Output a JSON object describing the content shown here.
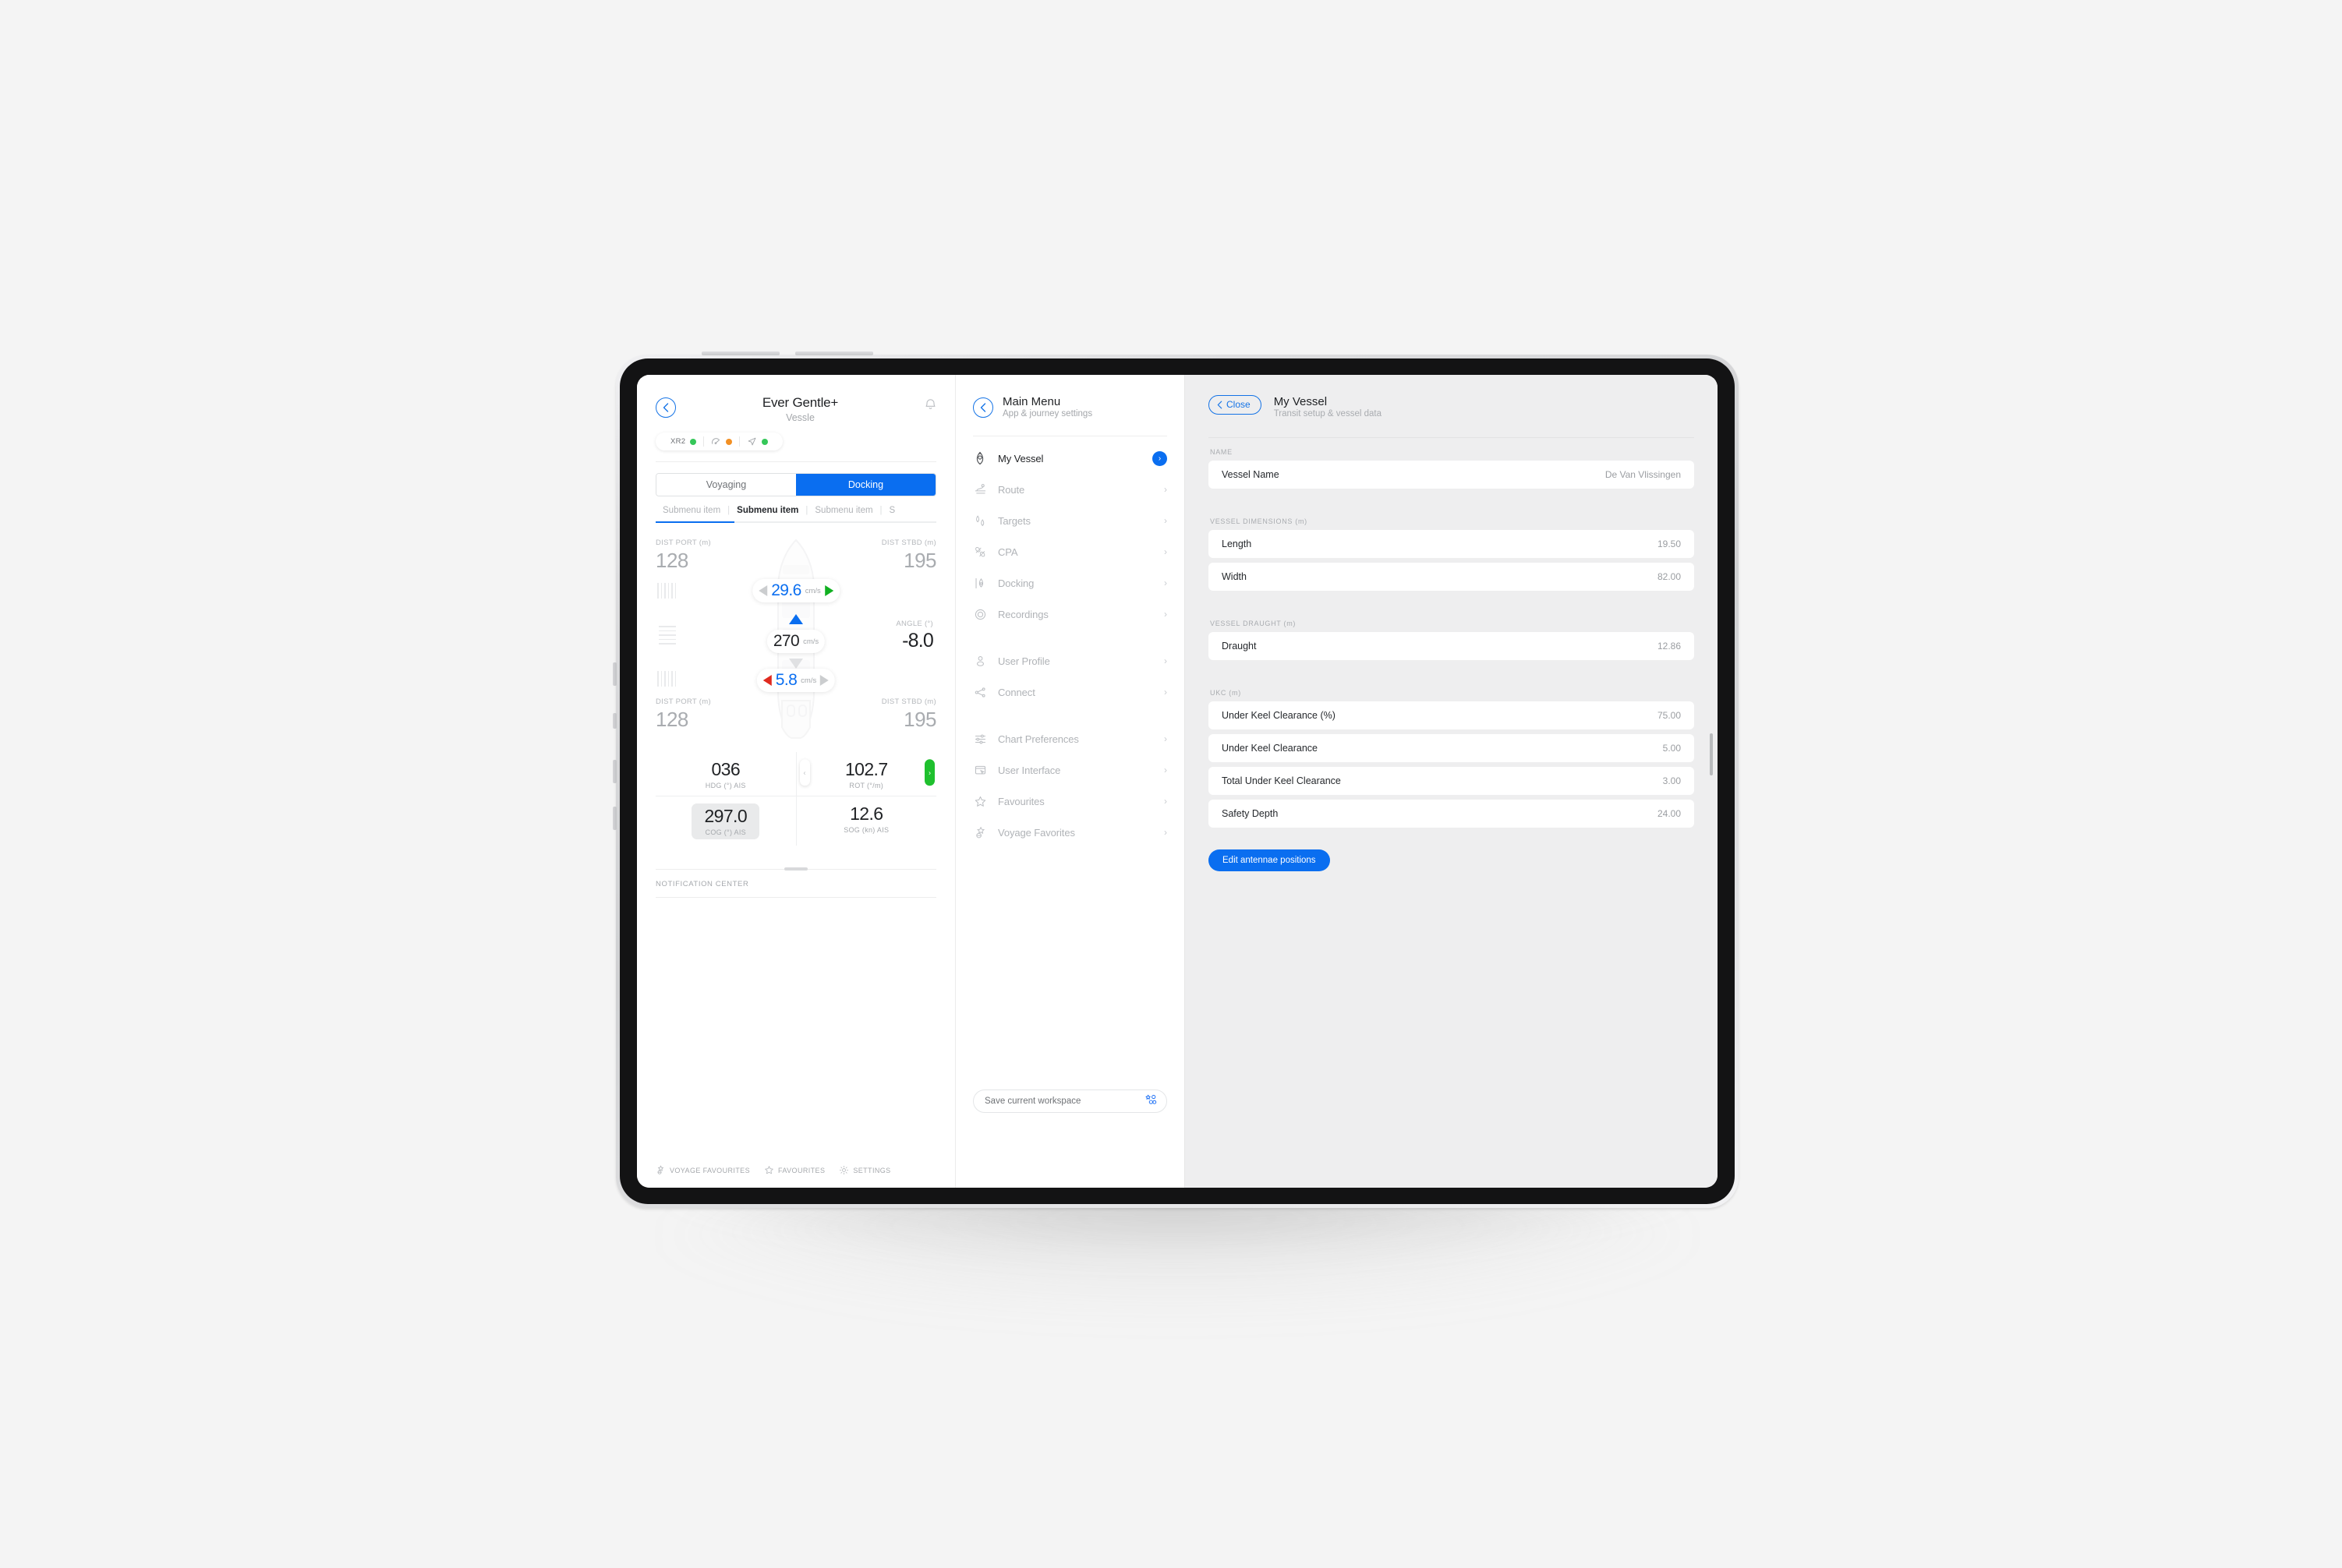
{
  "left_panel": {
    "back_icon": "chevron-left-icon",
    "title": "Ever Gentle+",
    "subtitle": "Vessle",
    "bell_icon": "bell-icon",
    "status": [
      {
        "label": "XR2",
        "icon": "text-label",
        "dot_color": "#35c759"
      },
      {
        "label": "",
        "icon": "gauge-icon",
        "dot_color": "#f29024"
      },
      {
        "label": "",
        "icon": "navigation-arrow-icon",
        "dot_color": "#35c759"
      }
    ],
    "segments": [
      {
        "label": "Voyaging",
        "active": false
      },
      {
        "label": "Docking",
        "active": true
      }
    ],
    "submenu": [
      {
        "label": "Submenu item",
        "active": false
      },
      {
        "label": "Submenu item",
        "active": true
      },
      {
        "label": "Submenu item",
        "active": false
      },
      {
        "label": "S",
        "active": false
      }
    ],
    "docking": {
      "dist_port_top_label": "DIST PORT (m)",
      "dist_port_top_value": "128",
      "dist_stbd_top_label": "DIST STBD (m)",
      "dist_stbd_top_value": "195",
      "dist_port_bottom_label": "DIST PORT (m)",
      "dist_port_bottom_value": "128",
      "dist_stbd_bottom_label": "DIST STBD (m)",
      "dist_stbd_bottom_value": "195",
      "bow_value": "29.6",
      "bow_unit": "cm/s",
      "center_value": "270",
      "center_unit": "cm/s",
      "stern_value": "5.8",
      "stern_unit": "cm/s",
      "angle_label": "ANGLE (°)",
      "angle_value": "-8.0"
    },
    "instruments": [
      {
        "value": "036",
        "caption": "HDG (°) AIS",
        "highlight": false,
        "stepper": false
      },
      {
        "value": "102.7",
        "caption": "ROT (°/m)",
        "highlight": false,
        "stepper": true
      },
      {
        "value": "297.0",
        "caption": "COG (°) AIS",
        "highlight": true,
        "stepper": false
      },
      {
        "value": "12.6",
        "caption": "SOG (kn) AIS",
        "highlight": false,
        "stepper": false
      }
    ],
    "stepper_left_icon": "chevron-left-icon",
    "stepper_right_icon": "chevron-right-icon",
    "notification_center_label": "NOTIFICATION CENTER",
    "footer": [
      {
        "label": "VOYAGE FAVOURITES",
        "icon": "voyage-favourites-icon"
      },
      {
        "label": "FAVOURITES",
        "icon": "star-icon"
      },
      {
        "label": "SETTINGS",
        "icon": "gear-icon"
      }
    ]
  },
  "mid_panel": {
    "back_icon": "chevron-left-icon",
    "title": "Main Menu",
    "subtitle": "App & journey settings",
    "items": [
      {
        "label": "My Vessel",
        "icon": "vessel-icon",
        "active": true,
        "badge": "›"
      },
      {
        "label": "Route",
        "icon": "route-icon",
        "active": false,
        "badge": ""
      },
      {
        "label": "Targets",
        "icon": "targets-icon",
        "active": false,
        "badge": ""
      },
      {
        "label": "CPA",
        "icon": "cpa-icon",
        "active": false,
        "badge": ""
      },
      {
        "label": "Docking",
        "icon": "docking-icon",
        "active": false,
        "badge": ""
      },
      {
        "label": "Recordings",
        "icon": "record-circle-icon",
        "active": false,
        "badge": ""
      },
      {
        "label": "User Profile",
        "icon": "user-icon",
        "active": false,
        "badge": ""
      },
      {
        "label": "Connect",
        "icon": "connect-icon",
        "active": false,
        "badge": ""
      },
      {
        "label": "Chart Preferences",
        "icon": "sliders-icon",
        "active": false,
        "badge": ""
      },
      {
        "label": "User Interface",
        "icon": "window-cursor-icon",
        "active": false,
        "badge": ""
      },
      {
        "label": "Favourites",
        "icon": "star-icon",
        "active": false,
        "badge": ""
      },
      {
        "label": "Voyage Favorites",
        "icon": "voyage-favourites-icon",
        "active": false,
        "badge": ""
      }
    ],
    "chevron": "›",
    "save_workspace_label": "Save current workspace",
    "save_workspace_icon": "workspace-icon"
  },
  "right_panel": {
    "close_label": "Close",
    "close_icon": "chevron-left-icon",
    "title": "My Vessel",
    "subtitle": "Transit setup & vessel data",
    "groups": [
      {
        "label": "NAME",
        "fields": [
          {
            "key": "Vessel Name",
            "value": "De Van Vlissingen"
          }
        ]
      },
      {
        "label": "VESSEL DIMENSIONS (m)",
        "fields": [
          {
            "key": "Length",
            "value": "19.50"
          },
          {
            "key": "Width",
            "value": "82.00"
          }
        ]
      },
      {
        "label": "VESSEL DRAUGHT (m)",
        "fields": [
          {
            "key": "Draught",
            "value": "12.86"
          }
        ]
      },
      {
        "label": "UKC (m)",
        "fields": [
          {
            "key": "Under Keel Clearance (%)",
            "value": "75.00"
          },
          {
            "key": "Under Keel Clearance",
            "value": "5.00"
          },
          {
            "key": "Total Under Keel Clearance",
            "value": "3.00"
          },
          {
            "key": "Safety Depth",
            "value": "24.00"
          }
        ]
      }
    ],
    "antenna_button_label": "Edit antennae positions"
  },
  "colors": {
    "accent": "#0a6ef0",
    "accent_outline": "#1473e6",
    "green": "#11b021",
    "green_dot": "#35c759",
    "orange_dot": "#f29024",
    "red": "#e02a1f",
    "panel_bg": "#eeeeef",
    "page_bg": "#f4f4f4"
  }
}
